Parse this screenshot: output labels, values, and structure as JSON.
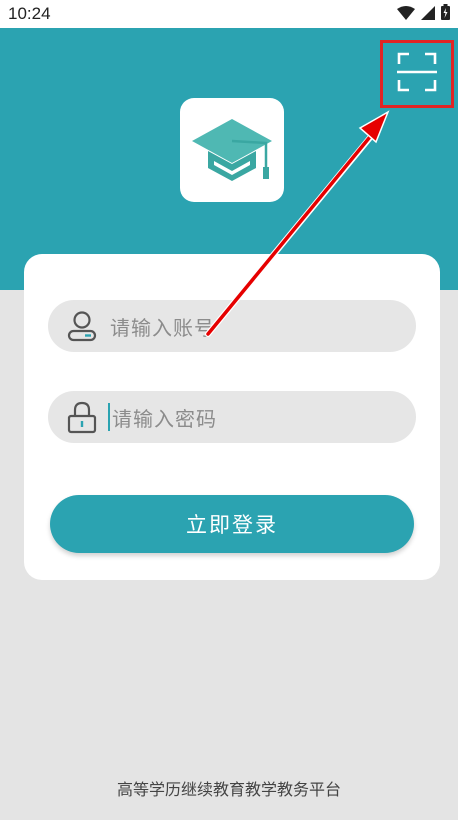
{
  "status_bar": {
    "time": "10:24",
    "icons": [
      "wifi-icon",
      "signal-icon",
      "battery-icon"
    ]
  },
  "header": {
    "scan_icon": "scan-icon",
    "logo_icon": "graduation-cap-icon"
  },
  "login_form": {
    "account_placeholder": "请输入账号",
    "password_placeholder": "请输入密码",
    "account_icon": "user-icon",
    "password_icon": "lock-icon",
    "login_label": "立即登录"
  },
  "footer": {
    "text": "高等学历继续教育教学教务平台"
  },
  "colors": {
    "primary": "#2ba3b1",
    "page_background": "#e4e4e4",
    "field_background": "#e6e6e6",
    "highlight": "#e12424"
  },
  "annotation": {
    "type": "red-arrow",
    "highlights": "scan-button"
  }
}
